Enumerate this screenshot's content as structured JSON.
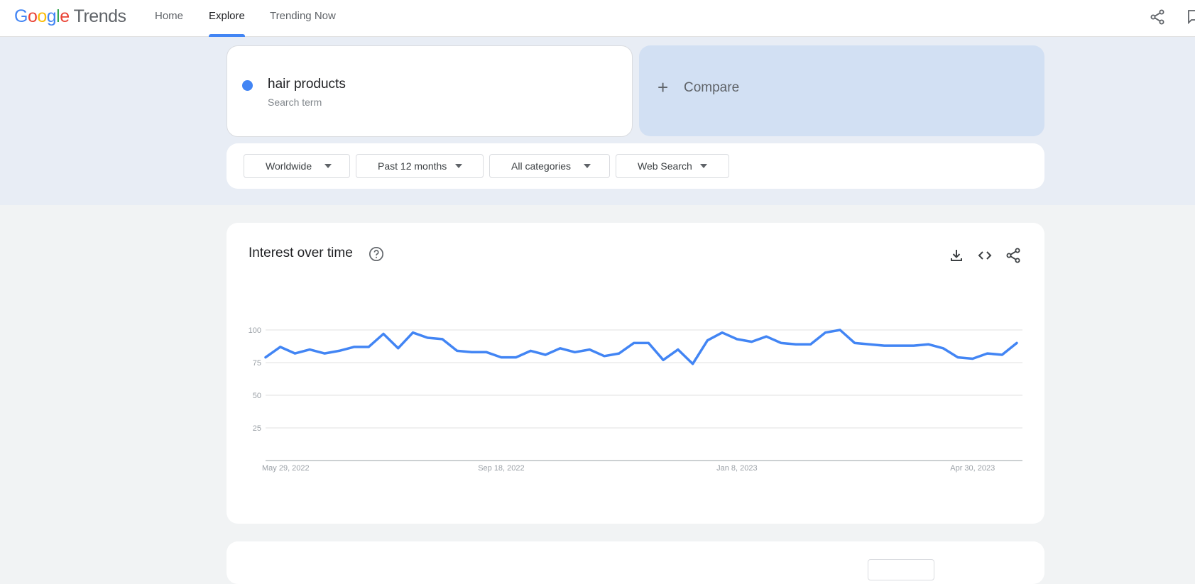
{
  "app": {
    "logo_letters": [
      "G",
      "o",
      "o",
      "g",
      "l",
      "e"
    ],
    "logo_suffix": "Trends"
  },
  "nav": {
    "tabs": [
      {
        "label": "Home"
      },
      {
        "label": "Explore"
      },
      {
        "label": "Trending Now"
      }
    ],
    "active_tab": "Explore",
    "icons": [
      "share-icon",
      "feedback-icon"
    ]
  },
  "search": {
    "term": "hair products",
    "term_type": "Search term",
    "term_color": "#4285f4",
    "compare_label": "Compare"
  },
  "filters": {
    "region": "Worldwide",
    "time_range": "Past 12 months",
    "category": "All categories",
    "property": "Web Search"
  },
  "interest_panel": {
    "title": "Interest over time",
    "icons": [
      "help-icon",
      "download-icon",
      "embed-icon",
      "share-icon"
    ]
  },
  "chart_data": {
    "type": "line",
    "title": "Interest over time",
    "y_ticks": [
      "100",
      "75",
      "50",
      "25"
    ],
    "x_tick_labels": [
      "May 29, 2022",
      "Sep 18, 2022",
      "Jan 8, 2023",
      "Apr 30, 2023"
    ],
    "ylim": [
      0,
      100
    ],
    "grid": true,
    "series": [
      {
        "name": "hair products",
        "color": "#4285f4",
        "values": [
          79,
          87,
          82,
          85,
          82,
          84,
          87,
          87,
          97,
          86,
          98,
          94,
          93,
          84,
          83,
          83,
          79,
          79,
          84,
          81,
          86,
          83,
          85,
          80,
          82,
          90,
          90,
          77,
          85,
          74,
          92,
          98,
          93,
          91,
          95,
          90,
          89,
          89,
          98,
          100,
          90,
          89,
          88,
          88,
          88,
          89,
          86,
          79,
          78,
          82,
          81,
          90
        ]
      }
    ]
  }
}
